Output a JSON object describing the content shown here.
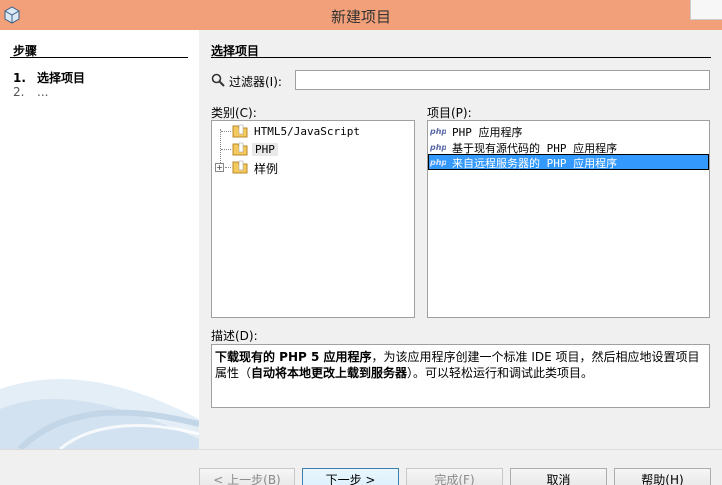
{
  "window": {
    "title": "新建项目"
  },
  "steps": {
    "title": "步骤",
    "items": [
      {
        "num": "1.",
        "label": "选择项目"
      },
      {
        "num": "2.",
        "label": "..."
      }
    ]
  },
  "main": {
    "heading": "选择项目",
    "filter": {
      "label": "过滤器(I):",
      "value": ""
    },
    "categories": {
      "label": "类别(C):",
      "items": [
        "HTML5/JavaScript",
        "PHP",
        "样例"
      ],
      "selected": "PHP"
    },
    "projects": {
      "label": "项目(P):",
      "items": [
        "PHP 应用程序",
        "基于现有源代码的 PHP 应用程序",
        "来自远程服务器的 PHP 应用程序"
      ],
      "selected": "来自远程服务器的 PHP 应用程序"
    },
    "description": {
      "label": "描述(D):",
      "bold1": "下载现有的 PHP 5 应用程序",
      "text1": "，为该应用程序创建一个标准 IDE 项目，然后相应地设置项目属性（",
      "bold2": "自动将本地更改上载到服务器",
      "text2": "）。可以轻松运行和调试此类项目。"
    }
  },
  "buttons": {
    "back": "< 上一步(B)",
    "next": "下一步 >",
    "finish": "完成(F)",
    "cancel": "取消",
    "help": "帮助(H)"
  },
  "colors": {
    "titlebar": "#f1a079",
    "selection": "#3399ff"
  }
}
